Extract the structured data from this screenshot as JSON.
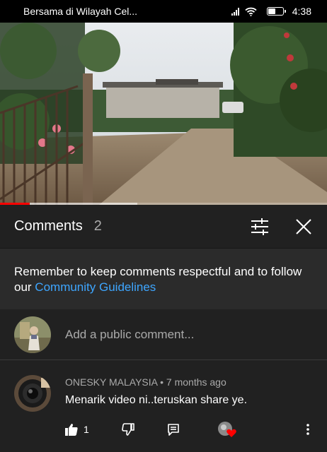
{
  "status_bar": {
    "title": "Bersama di Wilayah Cel...",
    "time": "4:38",
    "battery_level": 0.55
  },
  "video": {
    "progress_played": 0.09,
    "progress_buffered": 0.42
  },
  "comments_panel": {
    "title": "Comments",
    "count": "2",
    "filter_icon": "sort-filter-icon",
    "close_icon": "close-icon"
  },
  "guidelines": {
    "text": "Remember to keep comments respectful and to follow our ",
    "link": "Community Guidelines"
  },
  "add_comment": {
    "placeholder": "Add a public comment..."
  },
  "comment": {
    "author": "ONESKY MALAYSIA",
    "separator": " • ",
    "time": "7 months ago",
    "text": "Menarik video ni..teruskan share ye.",
    "likes": "1"
  },
  "colors": {
    "background": "#212121",
    "guidelines_bg": "#2b2b2b",
    "link": "#3ea6ff",
    "progress": "#ff0000",
    "heart": "#ff0000"
  }
}
